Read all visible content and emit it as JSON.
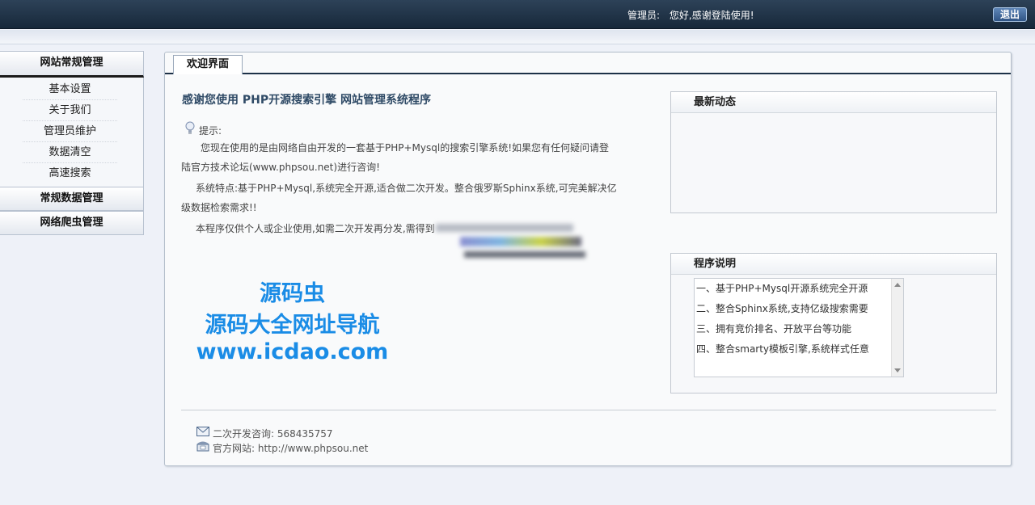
{
  "header": {
    "admin_label": "管理员:",
    "greeting": "您好,感谢登陆使用!",
    "logout_label": "退出"
  },
  "sidebar": {
    "groups": [
      {
        "label": "网站常规管理"
      },
      {
        "label": "常规数据管理"
      },
      {
        "label": "网络爬虫管理"
      }
    ],
    "items": [
      {
        "label": "基本设置"
      },
      {
        "label": "关于我们"
      },
      {
        "label": "管理员维护"
      },
      {
        "label": "数据清空"
      },
      {
        "label": "高速搜索"
      }
    ]
  },
  "main": {
    "tab_label": "欢迎界面",
    "headline": "感谢您使用 PHP开源搜索引擎 网站管理系统程序",
    "hint_label": "提示:",
    "paragraphs": [
      "您现在使用的是由网络自由开发的一套基于PHP+Mysql的搜索引擎系统!如果您有任何疑问请登陆官方技术论坛(www.phpsou.net)进行咨询!",
      "系统特点:基于PHP+Mysql,系统完全开源,适合做二次开发。整合俄罗斯Sphinx系统,可完美解决亿级数据检索需求!!",
      "本程序仅供个人或企业使用,如需二次开发再分发,需得到"
    ],
    "watermark": [
      "源码虫",
      "源码大全网址导航",
      "www.icdao.com"
    ],
    "contact_consult": "二次开发咨询: 568435757",
    "contact_site": "官方网站: http://www.phpsou.net"
  },
  "news_box": {
    "title": "最新动态"
  },
  "program_box": {
    "title": "程序说明",
    "items": [
      "一、基于PHP+Mysql开源系统完全开源",
      "二、整合Sphinx系统,支持亿级搜索需要",
      "三、拥有竞价排名、开放平台等功能",
      "四、整合smarty模板引擎,系统样式任意"
    ]
  },
  "colors": {
    "topbar": "#17283a",
    "accent": "#2f4a66",
    "watermark": "#1a8ce6"
  }
}
